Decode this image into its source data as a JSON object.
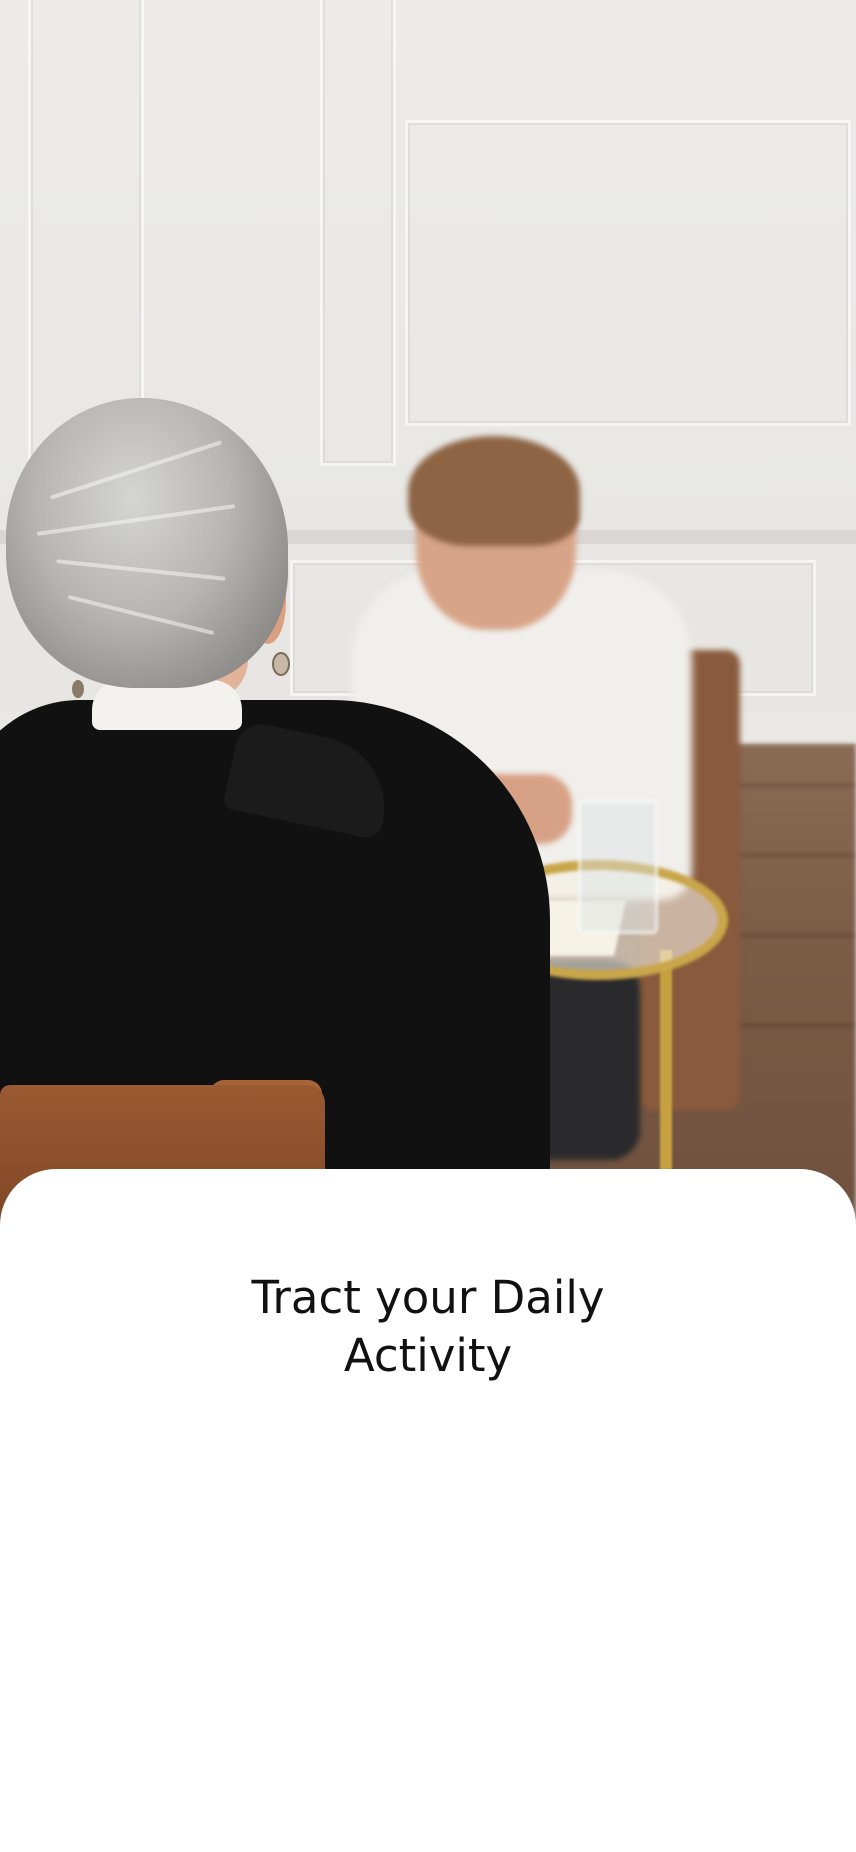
{
  "onboarding": {
    "hero_image_alt": "Two people sitting at a small table having a conversation",
    "title_line1": "Tract your Daily",
    "title_line2": "Activity"
  }
}
